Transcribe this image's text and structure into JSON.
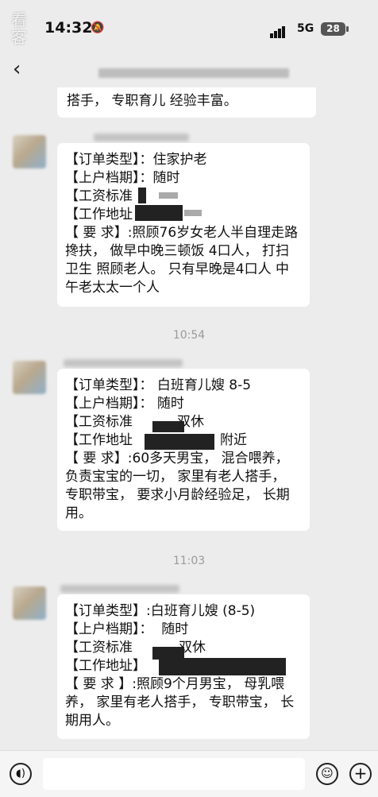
{
  "status_bar": {
    "time": "14:32",
    "mute_icon": "bell-slash-icon",
    "network": "5G",
    "battery": "28",
    "watermark": [
      "看",
      "客"
    ]
  },
  "header": {
    "back_icon": "chevron-left-icon"
  },
  "messages": [
    {
      "text_lines": [
        "搭手， 专职育儿 经验丰富。"
      ]
    },
    {
      "lines": [
        "【订单类型】：住家护老",
        "【上户档期】：随时",
        "【工资标准",
        "【工作地址",
        "【  要   求】:照顾76岁女老人半自理走路搀扶， 做早中晚三顿饭 4口人， 打扫卫生 照顾老人。 只有早晚是4口人 中午老太太一个人"
      ]
    },
    {
      "time": "10:54",
      "lines": [
        "【订单类型】： 白班育儿嫂 8-5",
        "【上户档期】： 随时",
        "【工资标准",
        "【工作地址",
        "【  要    求】:60多天男宝， 混合喂养， 负责宝宝的一切， 家里有老人搭手， 专职带宝， 要求小月龄经验足， 长期用。"
      ],
      "visible_fragments": {
        "wage_suffix": "双休",
        "address_suffix": "附近"
      }
    },
    {
      "time": "11:03",
      "lines": [
        "【订单类型】:白班育儿嫂 (8-5)",
        "【上户档期】：  随时",
        "【工资标准",
        "【工作地址】",
        "【 要   求 】:照顾9个月男宝， 母乳喂养， 家里有老人搭手， 专职带宝， 长期用人。"
      ],
      "visible_fragments": {
        "wage_suffix": "双休"
      }
    }
  ],
  "input_bar": {
    "voice_icon": "voice-icon",
    "emoji_icon": "emoji-icon",
    "plus_icon": "plus-icon"
  },
  "colors": {
    "background": "#ececec",
    "bubble": "#ffffff",
    "timestamp": "#9a9a9a"
  }
}
